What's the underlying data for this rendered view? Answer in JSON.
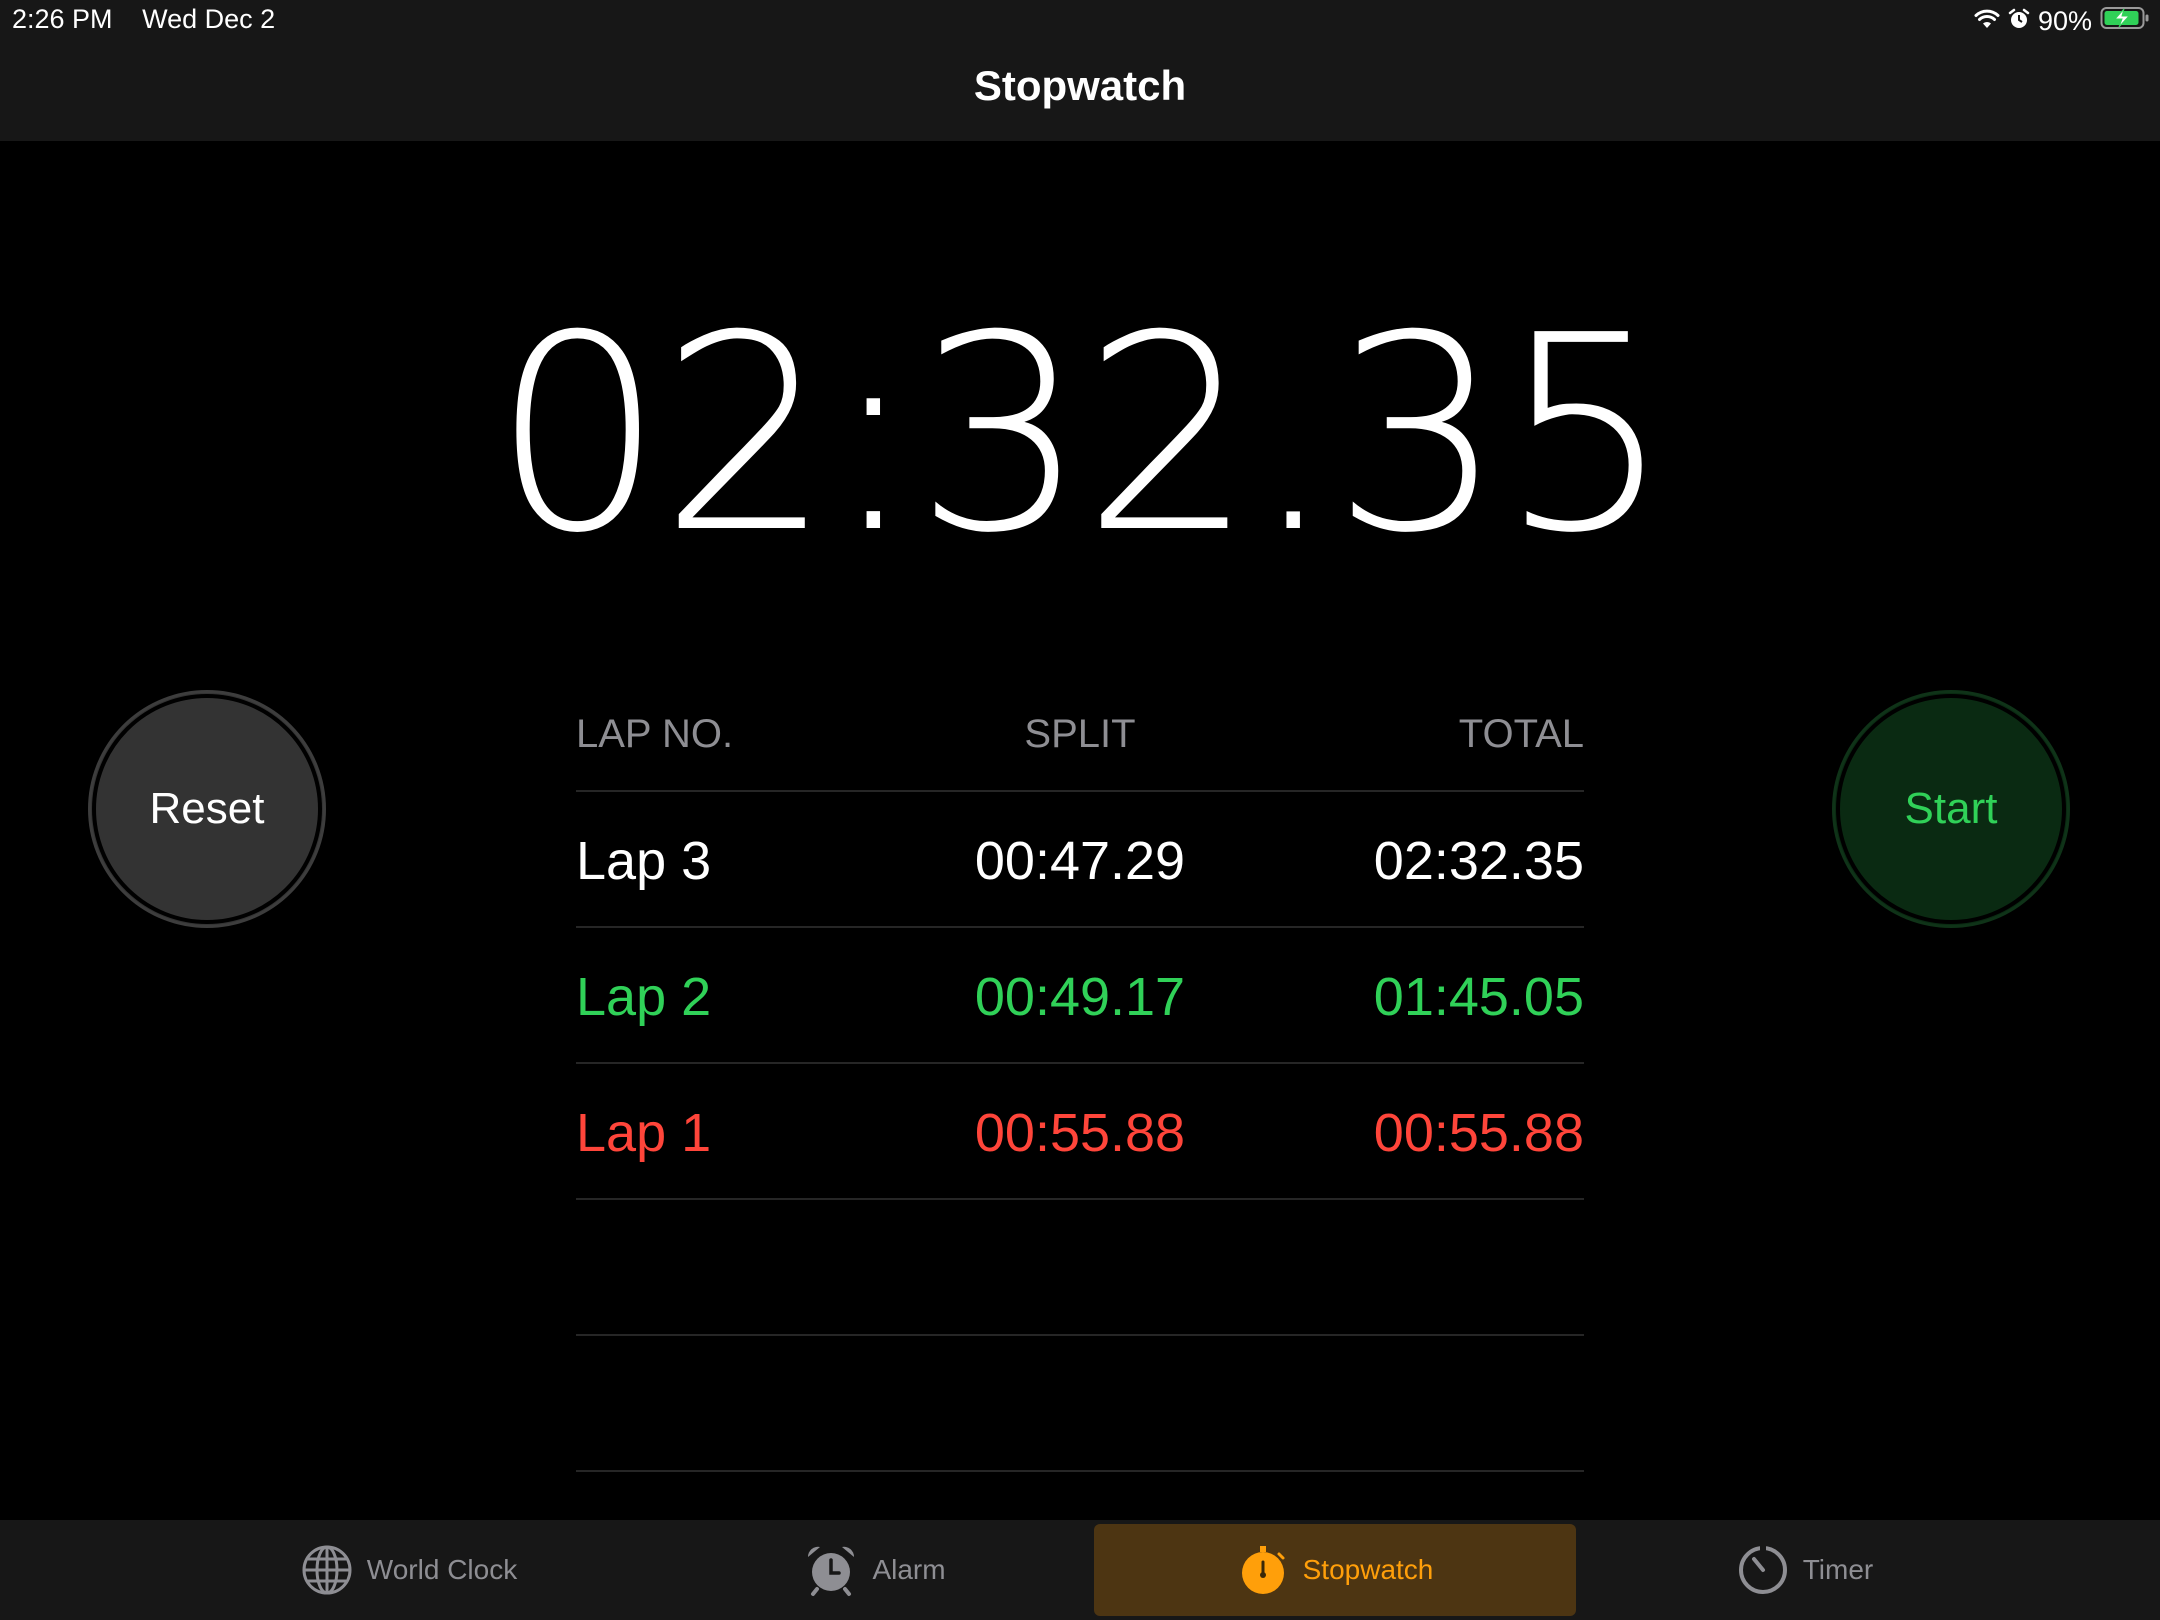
{
  "status_bar": {
    "time": "2:26 PM",
    "date": "Wed Dec 2",
    "battery": "90%"
  },
  "nav": {
    "title": "Stopwatch"
  },
  "stopwatch": {
    "display": "02:32.35"
  },
  "buttons": {
    "reset": "Reset",
    "start": "Start"
  },
  "laps": {
    "headers": {
      "lap": "LAP NO.",
      "split": "SPLIT",
      "total": "TOTAL"
    },
    "rows": [
      {
        "lap": "Lap 3",
        "split": "00:47.29",
        "total": "02:32.35",
        "status": "normal"
      },
      {
        "lap": "Lap 2",
        "split": "00:49.17",
        "total": "01:45.05",
        "status": "best"
      },
      {
        "lap": "Lap 1",
        "split": "00:55.88",
        "total": "00:55.88",
        "status": "worst"
      }
    ]
  },
  "tabs": [
    {
      "label": "World Clock",
      "icon": "globe-icon",
      "active": false
    },
    {
      "label": "Alarm",
      "icon": "alarm-clock-icon",
      "active": false
    },
    {
      "label": "Stopwatch",
      "icon": "stopwatch-icon",
      "active": true
    },
    {
      "label": "Timer",
      "icon": "timer-icon",
      "active": false
    }
  ],
  "colors": {
    "accent": "#ff9f0a",
    "best_lap": "#30d158",
    "worst_lap": "#ff453a",
    "background": "#000000"
  }
}
